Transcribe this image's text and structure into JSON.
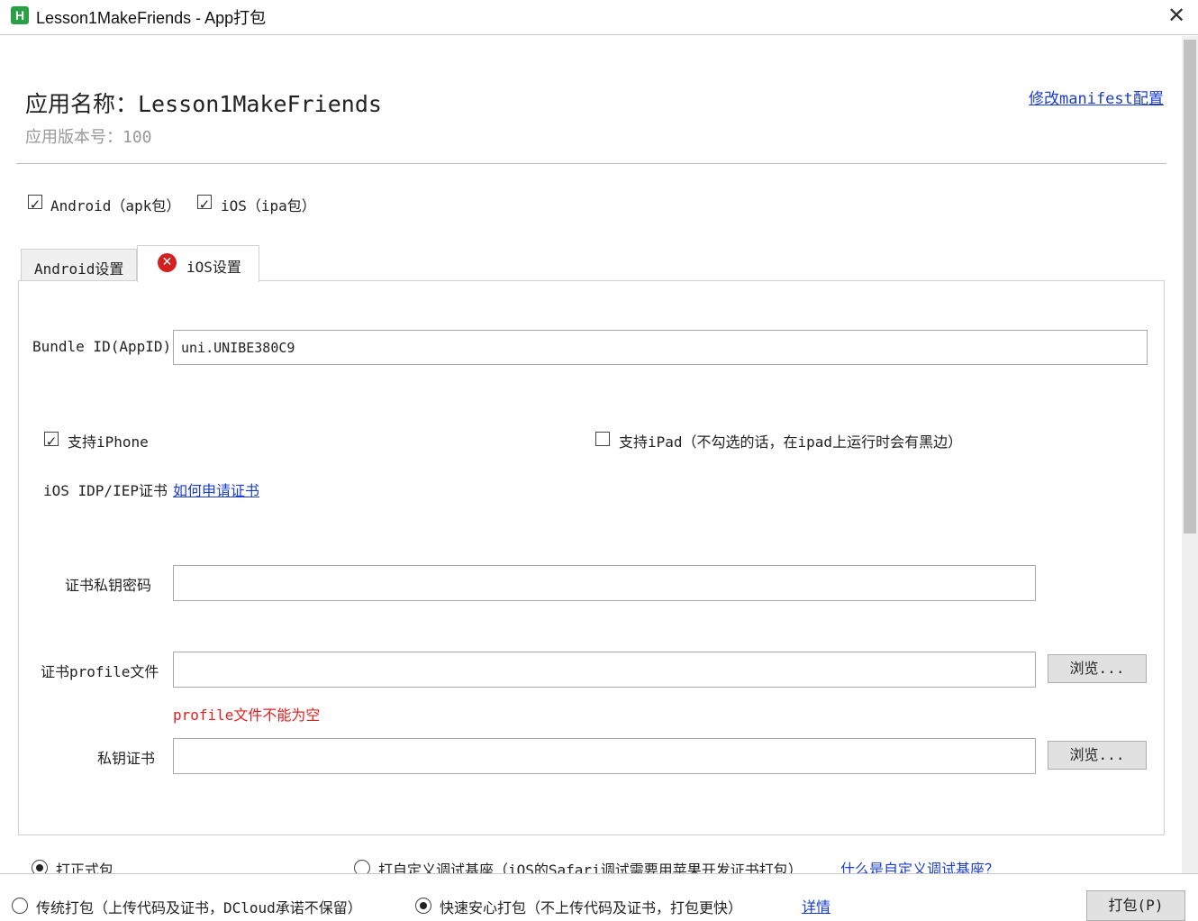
{
  "window": {
    "title": "Lesson1MakeFriends - App打包",
    "icon_letter": "H",
    "close_glyph": "✕"
  },
  "header": {
    "app_name": "应用名称：Lesson1MakeFriends",
    "app_version": "应用版本号：100",
    "manifest_link": "修改manifest配置"
  },
  "platforms": {
    "android": {
      "label": "Android（apk包）",
      "checked": true
    },
    "ios": {
      "label": "iOS（ipa包）",
      "checked": true
    }
  },
  "tabs": [
    {
      "label": "Android设置",
      "active": false
    },
    {
      "label": "iOS设置",
      "active": true,
      "status_icon": "error-icon"
    }
  ],
  "ios": {
    "bundle_label": "Bundle ID(AppID)",
    "bundle_value": "uni.UNIBE380C9",
    "support_iphone": {
      "label": "支持iPhone",
      "checked": true
    },
    "support_ipad": {
      "label": "支持iPad（不勾选的话，在ipad上运行时会有黑边）",
      "checked": false
    },
    "cert_label": "iOS IDP/IEP证书",
    "cert_link": "如何申请证书",
    "key_password_label": "证书私钥密码",
    "key_password_value": "",
    "profile_label": "证书profile文件",
    "profile_value": "",
    "browse_label": "浏览...",
    "profile_error": "profile文件不能为空",
    "private_cert_label": "私钥证书",
    "private_cert_value": "",
    "browse_label_2": "浏览..."
  },
  "build_type": {
    "release": {
      "label": "打正式包",
      "selected": true
    },
    "custom_base": {
      "label": "打自定义调试基座（iOS的Safari调试需要用苹果开发证书打包）",
      "selected": false
    },
    "custom_base_link": "什么是自定义调试基座？"
  },
  "bottom": {
    "traditional": {
      "label": "传统打包（上传代码及证书，DCloud承诺不保留）",
      "selected": false
    },
    "fast": {
      "label": "快速安心打包（不上传代码及证书，打包更快）",
      "selected": true
    },
    "details_link": "详情",
    "pack_button": "打包(P)"
  },
  "colors": {
    "link": "#1a3ccf",
    "error": "#e02020",
    "icon_green": "#2aa045",
    "error_icon": "#d32020"
  }
}
